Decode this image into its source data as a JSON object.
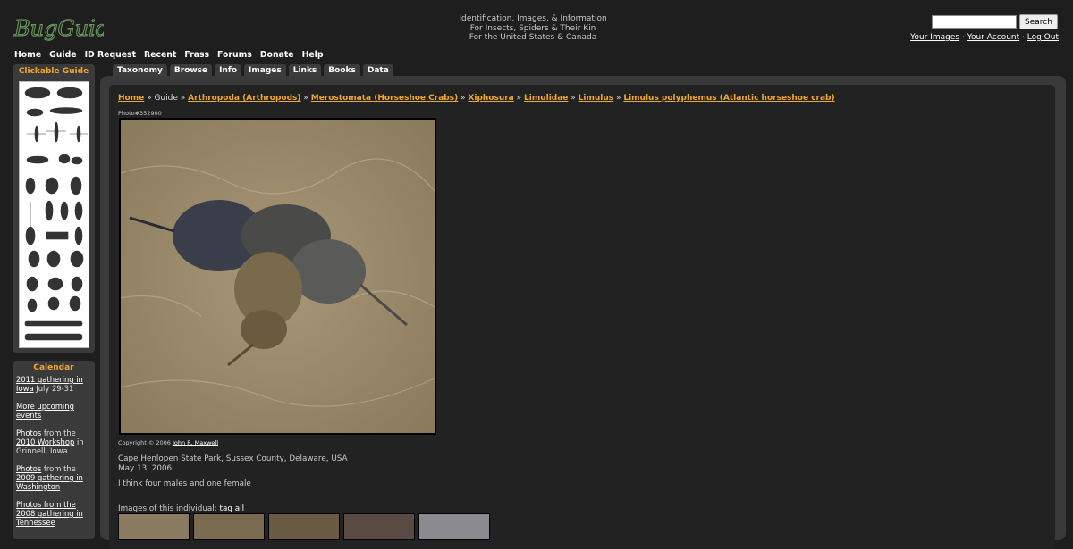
{
  "logo_text": "BugGuide",
  "tagline": [
    "Identification, Images, & Information",
    "For Insects, Spiders & Their Kin",
    "For the United States & Canada"
  ],
  "search": {
    "button": "Search",
    "value": ""
  },
  "account_links": [
    "Your Images",
    "Your Account",
    "Log Out"
  ],
  "topnav": [
    "Home",
    "Guide",
    "ID Request",
    "Recent",
    "Frass",
    "Forums",
    "Donate",
    "Help"
  ],
  "tabs": [
    "Taxonomy",
    "Browse",
    "Info",
    "Images",
    "Links",
    "Books",
    "Data"
  ],
  "sidebar": {
    "guide_title": "Clickable Guide",
    "calendar_title": "Calendar",
    "calendar": {
      "e1_link": "2011 gathering in Iowa",
      "e1_rest": " July 29-31",
      "e2_link": "More upcoming events",
      "e3_link1": "Photos",
      "e3_mid": " from the ",
      "e3_link2": "2010 Workshop",
      "e3_rest": " in Grinnell, Iowa",
      "e4_link1": "Photos",
      "e4_mid": " from the ",
      "e4_link2": "2009 gathering in Washington",
      "e5_link": "Photos from the 2008 gathering in Tennessee"
    }
  },
  "breadcrumb": [
    "Home",
    "Guide",
    "Arthropoda (Arthropods)",
    "Merostomata (Horseshoe Crabs)",
    "Xiphosura",
    "Limulidae",
    "Limulus",
    "Limulus polyphemus (Atlantic horseshoe crab)"
  ],
  "photo_number": "Photo#352900",
  "copyright": "Copyright © 2006",
  "photographer": "John R. Maxwell",
  "location": "Cape Henlopen State Park, Sussex County, Delaware, USA",
  "date": "May 13, 2006",
  "remarks": "I think four males and one female",
  "individual_label": "Images of this individual:",
  "tag_all": "tag all",
  "colors": {
    "accent": "#f0a830",
    "background": "#1e1e1e",
    "panel": "#3a3a3a"
  }
}
